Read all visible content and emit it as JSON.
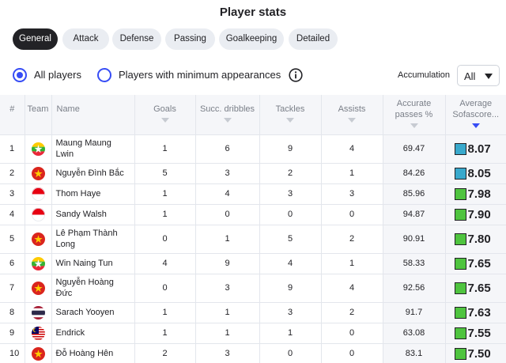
{
  "title": "Player stats",
  "tabs": [
    {
      "label": "General",
      "active": true
    },
    {
      "label": "Attack",
      "active": false
    },
    {
      "label": "Defense",
      "active": false
    },
    {
      "label": "Passing",
      "active": false
    },
    {
      "label": "Goalkeeping",
      "active": false
    },
    {
      "label": "Detailed",
      "active": false
    }
  ],
  "filters": {
    "all_players": "All players",
    "min_appearances": "Players with minimum appearances",
    "selected": "all_players",
    "accumulation_label": "Accumulation",
    "accumulation_value": "All"
  },
  "columns": [
    "#",
    "Team",
    "Name",
    "Goals",
    "Succ. dribbles",
    "Tackles",
    "Assists",
    "Accurate passes %",
    "Average Sofascore..."
  ],
  "sorted_column": "Average Sofascore...",
  "colors": {
    "accent": "#374df5",
    "rating_green": "#4fc43f",
    "rating_blue": "#39a9cc",
    "active_tab": "#222226"
  },
  "rows": [
    {
      "rank": "1",
      "team": "myanmar-flag",
      "name": [
        "Maung Maung",
        "Lwin"
      ],
      "goals": "1",
      "dribbles": "6",
      "tackles": "9",
      "assists": "4",
      "acc_pass": "69.47",
      "rating": "8.07",
      "rating_color": "#39a9cc"
    },
    {
      "rank": "2",
      "team": "vietnam-flag",
      "name": [
        "Nguyễn Đình Bắc"
      ],
      "goals": "5",
      "dribbles": "3",
      "tackles": "2",
      "assists": "1",
      "acc_pass": "84.26",
      "rating": "8.05",
      "rating_color": "#39a9cc"
    },
    {
      "rank": "3",
      "team": "indonesia-flag",
      "name": [
        "Thom Haye"
      ],
      "goals": "1",
      "dribbles": "4",
      "tackles": "3",
      "assists": "3",
      "acc_pass": "85.96",
      "rating": "7.98",
      "rating_color": "#4fc43f"
    },
    {
      "rank": "4",
      "team": "indonesia-flag",
      "name": [
        "Sandy Walsh"
      ],
      "goals": "1",
      "dribbles": "0",
      "tackles": "0",
      "assists": "0",
      "acc_pass": "94.87",
      "rating": "7.90",
      "rating_color": "#4fc43f"
    },
    {
      "rank": "5",
      "team": "vietnam-flag",
      "name": [
        "Lê Phạm Thành",
        "Long"
      ],
      "goals": "0",
      "dribbles": "1",
      "tackles": "5",
      "assists": "2",
      "acc_pass": "90.91",
      "rating": "7.80",
      "rating_color": "#4fc43f"
    },
    {
      "rank": "6",
      "team": "myanmar-flag",
      "name": [
        "Win Naing Tun"
      ],
      "goals": "4",
      "dribbles": "9",
      "tackles": "4",
      "assists": "1",
      "acc_pass": "58.33",
      "rating": "7.65",
      "rating_color": "#4fc43f"
    },
    {
      "rank": "7",
      "team": "vietnam-flag",
      "name": [
        "Nguyễn Hoàng",
        "Đức"
      ],
      "goals": "0",
      "dribbles": "3",
      "tackles": "9",
      "assists": "4",
      "acc_pass": "92.56",
      "rating": "7.65",
      "rating_color": "#4fc43f"
    },
    {
      "rank": "8",
      "team": "thailand-flag",
      "name": [
        "Sarach Yooyen"
      ],
      "goals": "1",
      "dribbles": "1",
      "tackles": "3",
      "assists": "2",
      "acc_pass": "91.7",
      "rating": "7.63",
      "rating_color": "#4fc43f"
    },
    {
      "rank": "9",
      "team": "malaysia-flag",
      "name": [
        "Endrick"
      ],
      "goals": "1",
      "dribbles": "1",
      "tackles": "1",
      "assists": "0",
      "acc_pass": "63.08",
      "rating": "7.55",
      "rating_color": "#4fc43f"
    },
    {
      "rank": "10",
      "team": "vietnam-flag",
      "name": [
        "Đỗ Hoàng Hên"
      ],
      "goals": "2",
      "dribbles": "3",
      "tackles": "0",
      "assists": "0",
      "acc_pass": "83.1",
      "rating": "7.50",
      "rating_color": "#4fc43f"
    }
  ]
}
